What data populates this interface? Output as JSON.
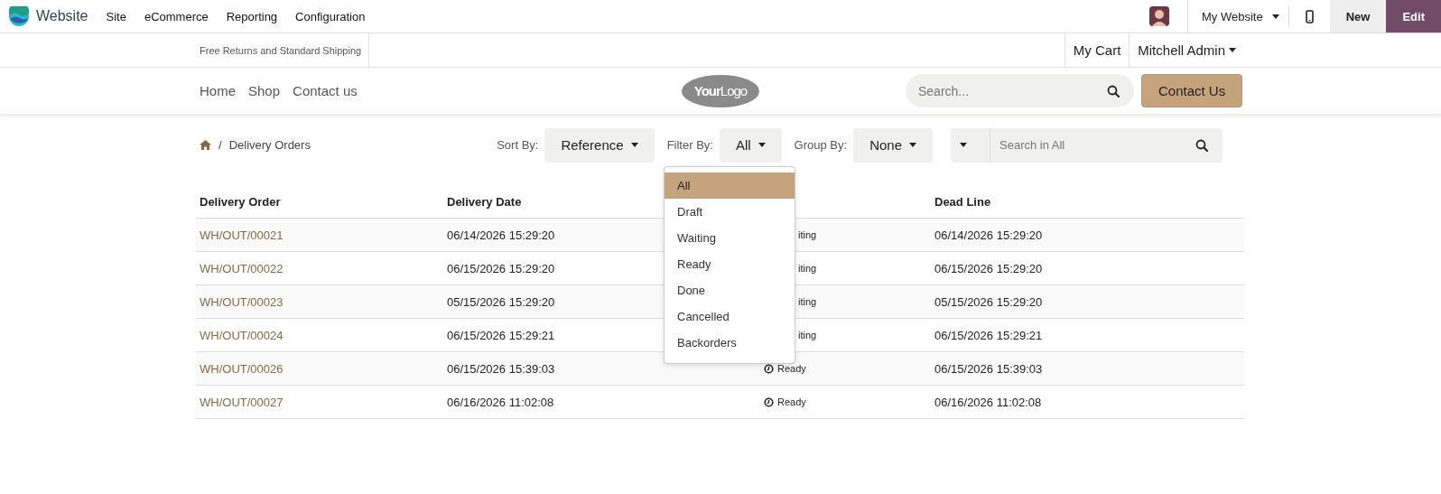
{
  "topbar": {
    "app": "Website",
    "menu": [
      "Site",
      "eCommerce",
      "Reporting",
      "Configuration"
    ],
    "website_switch": "My Website",
    "new": "New",
    "edit": "Edit"
  },
  "header": {
    "announcement": "Free Returns and Standard Shipping",
    "cart": "My Cart",
    "user": "Mitchell Admin"
  },
  "nav": {
    "links": [
      "Home",
      "Shop",
      "Contact us"
    ],
    "logo": "**Your**Logo",
    "search": {
      "placeholder": "Search..."
    },
    "cta": "Contact Us"
  },
  "breadcrumb": {
    "separator": "/",
    "current": "Delivery Orders"
  },
  "controls": {
    "sort_label": "Sort By:",
    "sort": "Reference",
    "filter_label": "Filter By:",
    "filter": "All",
    "group_label": "Group By:",
    "group": "None",
    "search": {
      "placeholder": "Search in All"
    }
  },
  "filter_menu": [
    {
      "label": "All",
      "selected": true
    },
    {
      "label": "Draft",
      "selected": false
    },
    {
      "label": "Waiting",
      "selected": false
    },
    {
      "label": "Ready",
      "selected": false
    },
    {
      "label": "Done",
      "selected": false
    },
    {
      "label": "Cancelled",
      "selected": false
    },
    {
      "label": "Backorders",
      "selected": false
    }
  ],
  "table": {
    "columns": [
      "Delivery Order",
      "Delivery Date",
      "Dead Line"
    ],
    "rows": [
      {
        "order": "WH/OUT/00021",
        "date": "06/14/2026 15:29:20",
        "status": "iting",
        "status_icon": false,
        "deadline": "06/14/2026 15:29:20"
      },
      {
        "order": "WH/OUT/00022",
        "date": "06/15/2026 15:29:20",
        "status": "iting",
        "status_icon": false,
        "deadline": "06/15/2026 15:29:20"
      },
      {
        "order": "WH/OUT/00023",
        "date": "05/15/2026 15:29:20",
        "status": "iting",
        "status_icon": false,
        "deadline": "05/15/2026 15:29:20"
      },
      {
        "order": "WH/OUT/00024",
        "date": "06/15/2026 15:29:21",
        "status": "iting",
        "status_icon": false,
        "deadline": "06/15/2026 15:29:21"
      },
      {
        "order": "WH/OUT/00026",
        "date": "06/15/2026 15:39:03",
        "status": "Ready",
        "status_icon": true,
        "deadline": "06/15/2026 15:39:03"
      },
      {
        "order": "WH/OUT/00027",
        "date": "06/16/2026 11:02:08",
        "status": "Ready",
        "status_icon": true,
        "deadline": "06/16/2026 11:02:08"
      }
    ]
  }
}
